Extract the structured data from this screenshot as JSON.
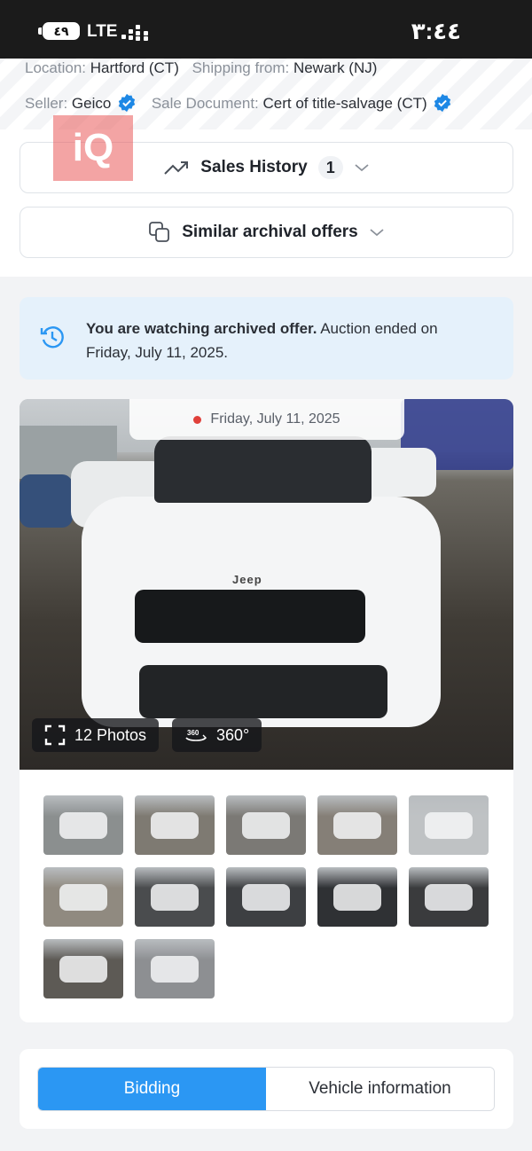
{
  "status_bar": {
    "battery": "٤٩",
    "network": "LTE",
    "time": "٣:٤٤"
  },
  "lot_info": {
    "location_label": "Location:",
    "location_value": "Hartford (CT)",
    "shipping_label": "Shipping from:",
    "shipping_value": "Newark (NJ)",
    "seller_label": "Seller:",
    "seller_value": "Geico",
    "sale_doc_label": "Sale Document:",
    "sale_doc_value": "Cert of title-salvage (CT)"
  },
  "watermark": "iQ",
  "sales_history": {
    "label": "Sales History",
    "count": "1"
  },
  "similar_offers": {
    "label": "Similar archival offers"
  },
  "archived_notice": {
    "bold": "You are watching archived offer.",
    "rest": " Auction ended on Friday, July 11, 2025."
  },
  "gallery": {
    "date": "Friday, July 11, 2025",
    "photos_label": "12 Photos",
    "view_360_label": "360°",
    "vehicle_badge": "Jeep",
    "thumbnails": [
      {
        "name": "front-left",
        "color": "#8b8f8f"
      },
      {
        "name": "rear-left",
        "color": "#7e7a72"
      },
      {
        "name": "rear",
        "color": "#7b7975"
      },
      {
        "name": "front-right",
        "color": "#857f77"
      },
      {
        "name": "front",
        "color": "#bfc2c4"
      },
      {
        "name": "rear-open",
        "color": "#908a80"
      },
      {
        "name": "interior-airbag",
        "color": "#4a4c4e"
      },
      {
        "name": "dashboard",
        "color": "#3d3f42"
      },
      {
        "name": "infotainment",
        "color": "#2f3134"
      },
      {
        "name": "rear-seats",
        "color": "#3a3b3d"
      },
      {
        "name": "engine",
        "color": "#5d5a55"
      },
      {
        "name": "door-label",
        "color": "#8d8f92"
      }
    ]
  },
  "tabs": {
    "bidding": "Bidding",
    "vehicle_info": "Vehicle information"
  },
  "colors": {
    "accent": "#2b97f3",
    "verified": "#1e88e5",
    "notice_bg": "#e5f1fb",
    "live_dot": "#e0403a"
  }
}
